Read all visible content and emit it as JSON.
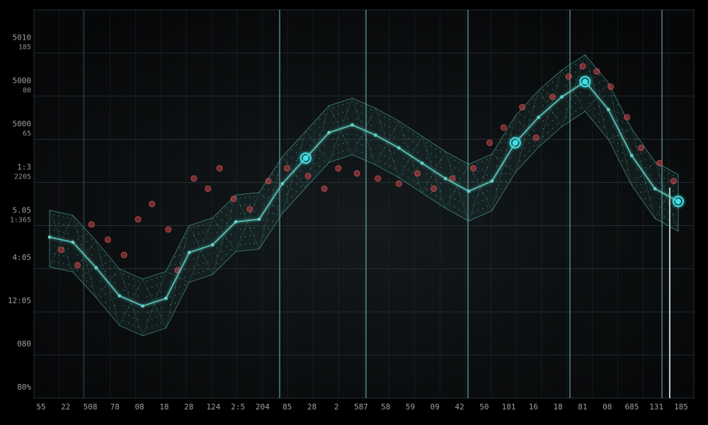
{
  "chart_data": {
    "type": "line",
    "title": "",
    "xlabel": "",
    "ylabel": "",
    "grid": true,
    "colors": {
      "background": "#0b0d0f",
      "grid": "#2a3034",
      "accent_line": "#7fd6d4",
      "mesh": "#63d1c8",
      "scatter": "#c0464b",
      "node": "#3fe0e6"
    },
    "y_tick_labels": [
      {
        "main": "5010",
        "sub": "185"
      },
      {
        "main": "5000",
        "sub": "80"
      },
      {
        "main": "5000",
        "sub": "65"
      },
      {
        "main": "1:3",
        "sub": "2205"
      },
      {
        "main": "5.05",
        "sub": "1:365"
      },
      {
        "main": "4:05",
        "sub": ""
      },
      {
        "main": "12:05",
        "sub": ""
      },
      {
        "main": "080",
        "sub": ""
      },
      {
        "main": "80%",
        "sub": ""
      }
    ],
    "x_tick_labels": [
      "55",
      "22",
      "508",
      "78",
      "08",
      "18",
      "28",
      "124",
      "2:5",
      "204",
      "85",
      "28",
      "2",
      "587",
      "58",
      "59",
      "09",
      "42",
      "50",
      "181",
      "16",
      "18",
      "81",
      "08",
      "685",
      "131",
      "185"
    ],
    "accent_x": [
      395,
      517,
      661,
      805,
      935
    ],
    "series": [
      {
        "values": [
          [
            0.0,
            285
          ],
          [
            1.0,
            275
          ],
          [
            2.0,
            225
          ],
          [
            3.0,
            170
          ],
          [
            4.0,
            150
          ],
          [
            5.0,
            165
          ],
          [
            6.0,
            255
          ],
          [
            7.0,
            270
          ],
          [
            8.0,
            315
          ],
          [
            9.0,
            320
          ],
          [
            10.0,
            390
          ],
          [
            11.0,
            440
          ],
          [
            12.0,
            490
          ],
          [
            13.0,
            505
          ],
          [
            14.0,
            485
          ],
          [
            15.0,
            460
          ],
          [
            16.0,
            430
          ],
          [
            17.0,
            400
          ],
          [
            18.0,
            375
          ],
          [
            19.0,
            395
          ],
          [
            20.0,
            470
          ],
          [
            21.0,
            520
          ],
          [
            22.0,
            560
          ],
          [
            23.0,
            590
          ],
          [
            24.0,
            535
          ],
          [
            25.0,
            445
          ],
          [
            26.0,
            380
          ],
          [
            27.0,
            355
          ]
        ]
      }
    ],
    "scatter_points": [
      [
        0.5,
        260
      ],
      [
        1.2,
        230
      ],
      [
        1.8,
        310
      ],
      [
        2.5,
        280
      ],
      [
        3.2,
        250
      ],
      [
        3.8,
        320
      ],
      [
        4.4,
        350
      ],
      [
        5.1,
        300
      ],
      [
        5.5,
        220
      ],
      [
        6.2,
        400
      ],
      [
        6.8,
        380
      ],
      [
        7.3,
        420
      ],
      [
        7.9,
        360
      ],
      [
        8.6,
        340
      ],
      [
        9.4,
        395
      ],
      [
        10.2,
        420
      ],
      [
        11.1,
        405
      ],
      [
        11.8,
        380
      ],
      [
        12.4,
        420
      ],
      [
        13.2,
        410
      ],
      [
        14.1,
        400
      ],
      [
        15.0,
        390
      ],
      [
        15.8,
        410
      ],
      [
        16.5,
        380
      ],
      [
        17.3,
        400
      ],
      [
        18.2,
        420
      ],
      [
        18.9,
        470
      ],
      [
        19.5,
        500
      ],
      [
        20.3,
        540
      ],
      [
        20.9,
        480
      ],
      [
        21.6,
        560
      ],
      [
        22.3,
        600
      ],
      [
        22.9,
        620
      ],
      [
        23.5,
        610
      ],
      [
        24.1,
        580
      ],
      [
        24.8,
        520
      ],
      [
        25.4,
        460
      ],
      [
        26.2,
        430
      ],
      [
        26.8,
        395
      ]
    ]
  }
}
